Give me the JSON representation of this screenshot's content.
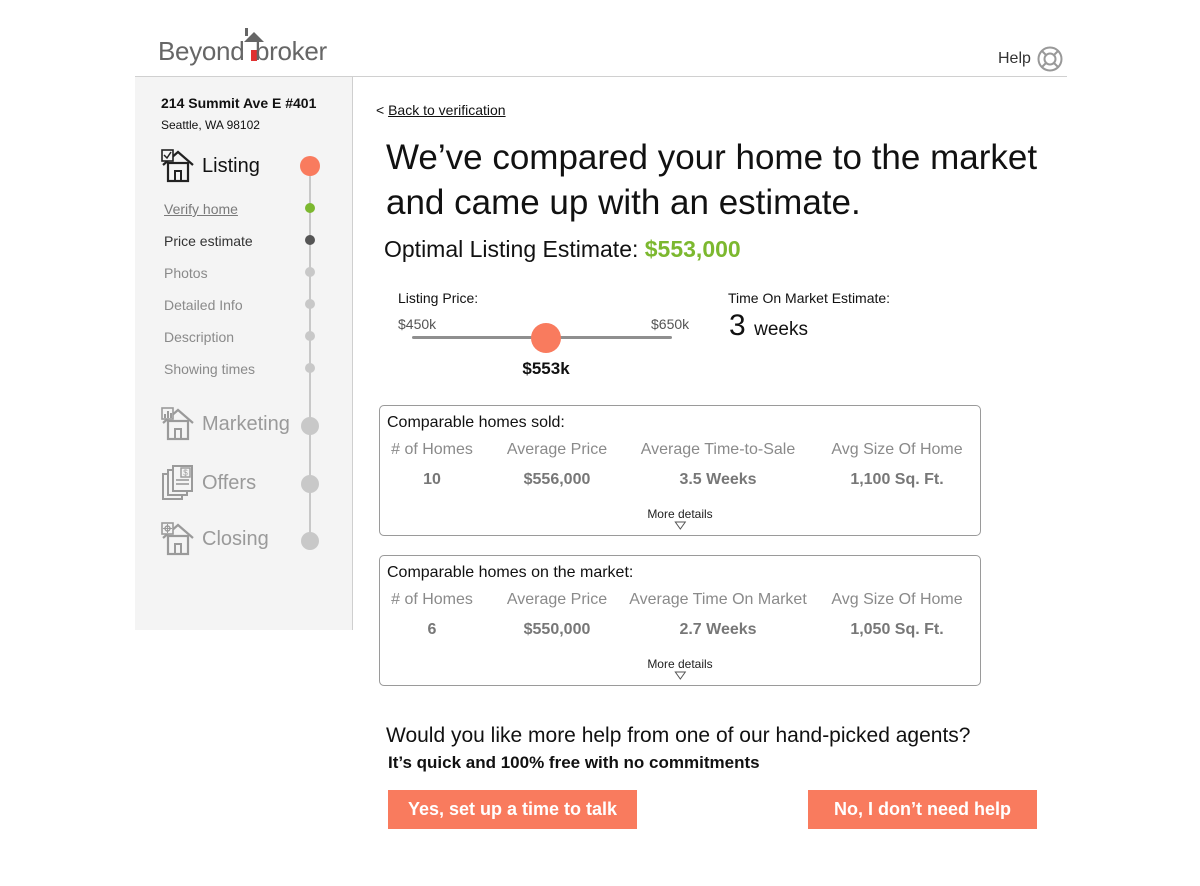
{
  "brand": {
    "name_left": "Beyond",
    "name_right": "broker",
    "accent": "#e03131",
    "icon": "house-logo-icon"
  },
  "header": {
    "help_label": "Help",
    "help_icon": "lifebuoy-icon"
  },
  "sidebar": {
    "address_line1": "214 Summit Ave E #401",
    "address_line2": "Seattle, WA 98102",
    "sections": [
      {
        "label": "Listing",
        "state": "active",
        "icon": "house-checklist-icon"
      },
      {
        "label": "Marketing",
        "state": "inactive",
        "icon": "house-chart-icon"
      },
      {
        "label": "Offers",
        "state": "inactive",
        "icon": "documents-dollar-icon"
      },
      {
        "label": "Closing",
        "state": "inactive",
        "icon": "house-gear-icon"
      }
    ],
    "steps": [
      {
        "label": "Verify home",
        "state": "done"
      },
      {
        "label": "Price estimate",
        "state": "current"
      },
      {
        "label": "Photos",
        "state": "todo"
      },
      {
        "label": "Detailed Info",
        "state": "todo"
      },
      {
        "label": "Description",
        "state": "todo"
      },
      {
        "label": "Showing times",
        "state": "todo"
      }
    ],
    "colors": {
      "active": "#f97b5e",
      "done": "#7cb82f",
      "current": "#555555",
      "todo": "#c8c8c8"
    }
  },
  "main": {
    "back_prefix": "<",
    "back_label": "Back to verification",
    "headline": "We’ve compared your home to the market and came up with an estimate.",
    "estimate_label": "Optimal Listing Estimate:",
    "estimate_value": "$553,000",
    "listing_price_label": "Listing Price:",
    "slider": {
      "min_label": "$450k",
      "max_label": "$650k",
      "value_label": "$553k",
      "min": 450,
      "max": 650,
      "value": 553
    },
    "tom_label": "Time On Market Estimate:",
    "tom_value": "3",
    "tom_unit": "weeks",
    "sold_card": {
      "title": "Comparable homes sold:",
      "headers": [
        "# of Homes",
        "Average Price",
        "Average Time-to-Sale",
        "Avg Size Of Home"
      ],
      "values": [
        "10",
        "$556,000",
        "3.5 Weeks",
        "1,100 Sq. Ft."
      ],
      "more_label": "More details"
    },
    "market_card": {
      "title": "Comparable homes on the market:",
      "headers": [
        "# of Homes",
        "Average Price",
        "Average Time On Market",
        "Avg Size Of Home"
      ],
      "values": [
        "6",
        "$550,000",
        "2.7 Weeks",
        "1,050 Sq. Ft."
      ],
      "more_label": "More details"
    },
    "cta_question": "Would you like more help from one of our hand-picked agents?",
    "cta_sub": "It’s quick and 100% free with no commitments",
    "yes_button": "Yes, set up a time to talk",
    "no_button": "No, I don’t need help",
    "accent": "#f97b5e"
  }
}
